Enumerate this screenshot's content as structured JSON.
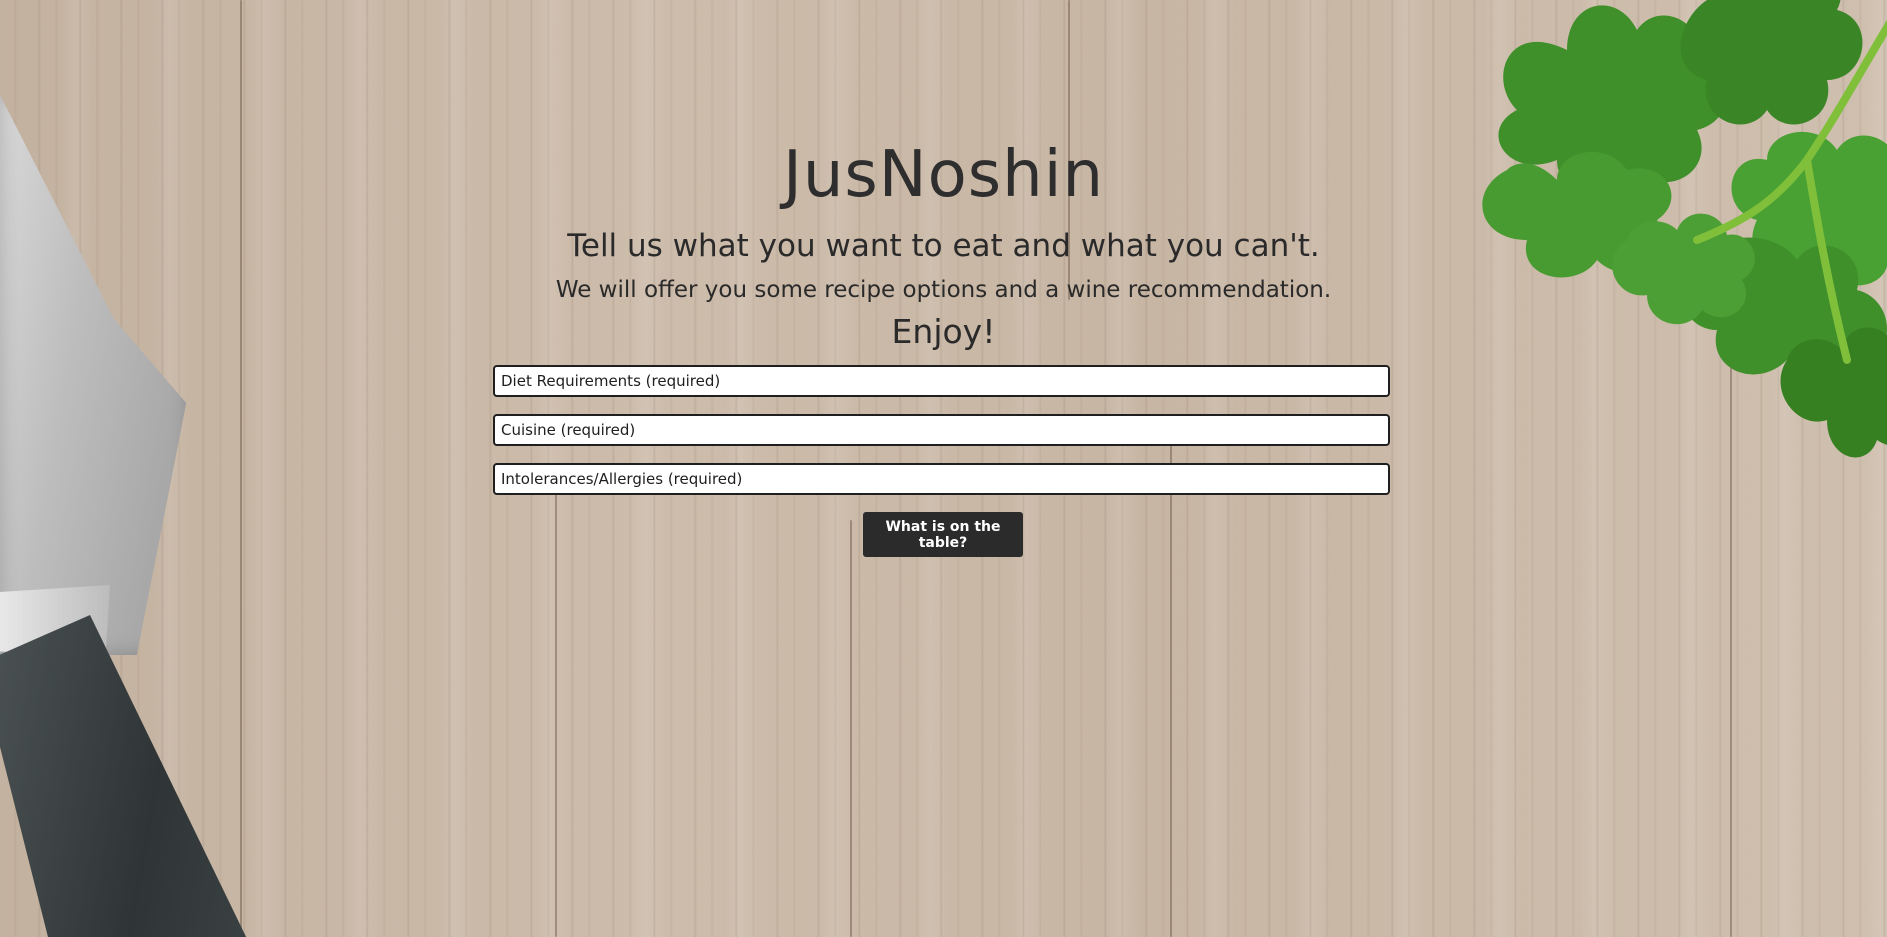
{
  "header": {
    "title": "JusNoshin",
    "subtitle": "Tell us what you want to eat and what you can't.",
    "description": "We will offer you some recipe options and a wine recommendation.",
    "enjoy": "Enjoy!"
  },
  "form": {
    "diet_placeholder": "Diet Requirements (required)",
    "cuisine_placeholder": "Cuisine (required)",
    "intolerances_placeholder": "Intolerances/Allergies (required)",
    "submit_label": "What is on the table?"
  },
  "colors": {
    "text": "#2e2e2e",
    "button_bg": "#2b2b2b",
    "button_text": "#ffffff",
    "field_border": "#1f1f1f",
    "wood": "#c9b7a5",
    "parsley": "#3f8f2a"
  },
  "decor": {
    "left_image": "chef-knife",
    "right_image": "parsley-leaves",
    "background": "wood-table-texture"
  }
}
